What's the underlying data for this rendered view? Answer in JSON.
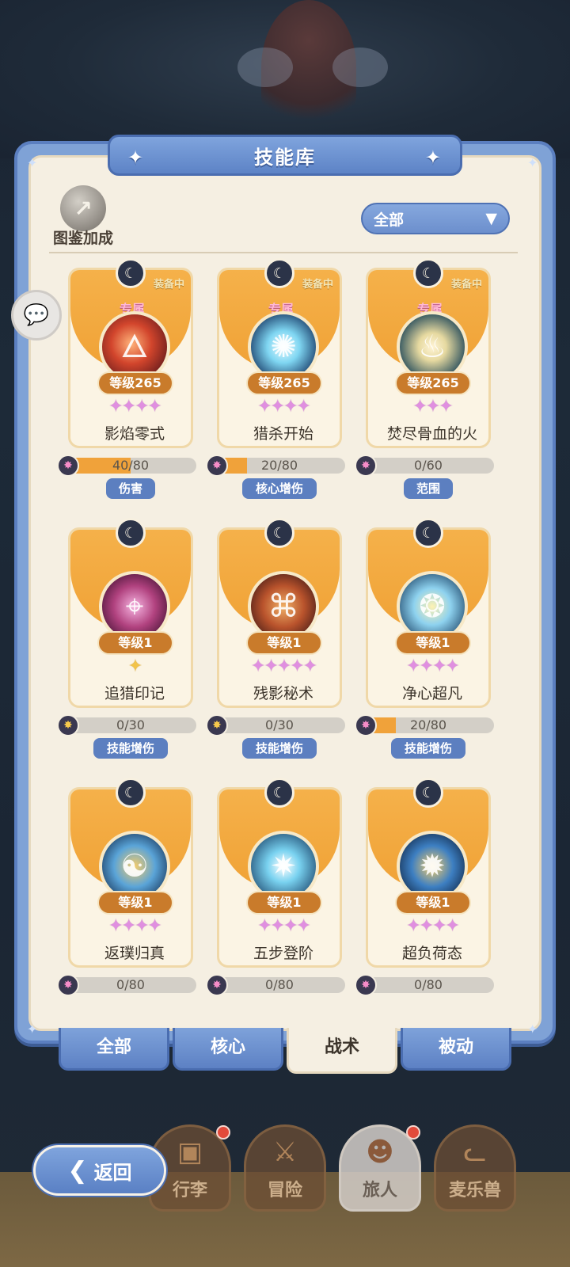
{
  "header": {
    "title": "技能库"
  },
  "collection": {
    "label": "图鉴加成"
  },
  "filter": {
    "selected": "全部"
  },
  "skills": [
    {
      "name": "影焰零式",
      "level": "等级265",
      "exclusive": "专属",
      "equipped": "装备中",
      "stars": "✦✦✦✦",
      "star_count": 4,
      "progress": "40/80",
      "progress_fraction": 0.5,
      "tag": "伤害",
      "icon": "fire-slash-icon",
      "gem": "pink"
    },
    {
      "name": "猎杀开始",
      "level": "等级265",
      "exclusive": "专属",
      "equipped": "装备中",
      "stars": "✦✦✦✦",
      "star_count": 4,
      "progress": "20/80",
      "progress_fraction": 0.25,
      "tag": "核心增伤",
      "icon": "ice-shatter-icon",
      "gem": "pink"
    },
    {
      "name": "焚尽骨血的火",
      "level": "等级265",
      "exclusive": "专属",
      "equipped": "装备中",
      "stars": "✦✦✦",
      "star_count": 3,
      "progress": "0/60",
      "progress_fraction": 0,
      "tag": "范围",
      "icon": "spirit-flame-icon",
      "gem": "pink"
    },
    {
      "name": "追猎印记",
      "level": "等级1",
      "exclusive": "",
      "equipped": "",
      "stars": "✦",
      "star_count": 1,
      "progress": "0/30",
      "progress_fraction": 0,
      "tag": "技能增伤",
      "icon": "crosshair-icon",
      "gem": "gold"
    },
    {
      "name": "残影秘术",
      "level": "等级1",
      "exclusive": "",
      "equipped": "",
      "stars": "✦✦✦✦✦",
      "star_count": 5,
      "progress": "0/30",
      "progress_fraction": 0,
      "tag": "技能增伤",
      "icon": "shadow-clone-icon",
      "gem": "gold"
    },
    {
      "name": "净心超凡",
      "level": "等级1",
      "exclusive": "",
      "equipped": "",
      "stars": "✦✦✦✦",
      "star_count": 4,
      "progress": "20/80",
      "progress_fraction": 0.25,
      "tag": "技能增伤",
      "icon": "pure-heart-icon",
      "gem": "pink"
    },
    {
      "name": "返璞归真",
      "level": "等级1",
      "exclusive": "",
      "equipped": "",
      "stars": "✦✦✦✦",
      "star_count": 4,
      "progress": "0/80",
      "progress_fraction": 0,
      "tag": "",
      "icon": "meditation-icon",
      "gem": "pink"
    },
    {
      "name": "五步登阶",
      "level": "等级1",
      "exclusive": "",
      "equipped": "",
      "stars": "✦✦✦✦",
      "star_count": 4,
      "progress": "0/80",
      "progress_fraction": 0,
      "tag": "",
      "icon": "ascension-icon",
      "gem": "pink"
    },
    {
      "name": "超负荷态",
      "level": "等级1",
      "exclusive": "",
      "equipped": "",
      "stars": "✦✦✦✦",
      "star_count": 4,
      "progress": "0/80",
      "progress_fraction": 0,
      "tag": "",
      "icon": "overload-icon",
      "gem": "pink"
    }
  ],
  "tabs": [
    {
      "label": "全部",
      "active": false
    },
    {
      "label": "核心",
      "active": false
    },
    {
      "label": "战术",
      "active": true
    },
    {
      "label": "被动",
      "active": false
    }
  ],
  "back_button": {
    "label": "返回"
  },
  "bottom_nav": [
    {
      "label": "行李",
      "badge": true
    },
    {
      "label": "冒险",
      "badge": false
    },
    {
      "label": "旅人",
      "badge": true
    },
    {
      "label": "麦乐兽",
      "badge": false
    }
  ],
  "colors": {
    "panel_blue": "#7fa2d6",
    "card_orange": "#f0a236",
    "panel_cream": "#f5efe2",
    "tag_blue": "#5c7fc0"
  }
}
